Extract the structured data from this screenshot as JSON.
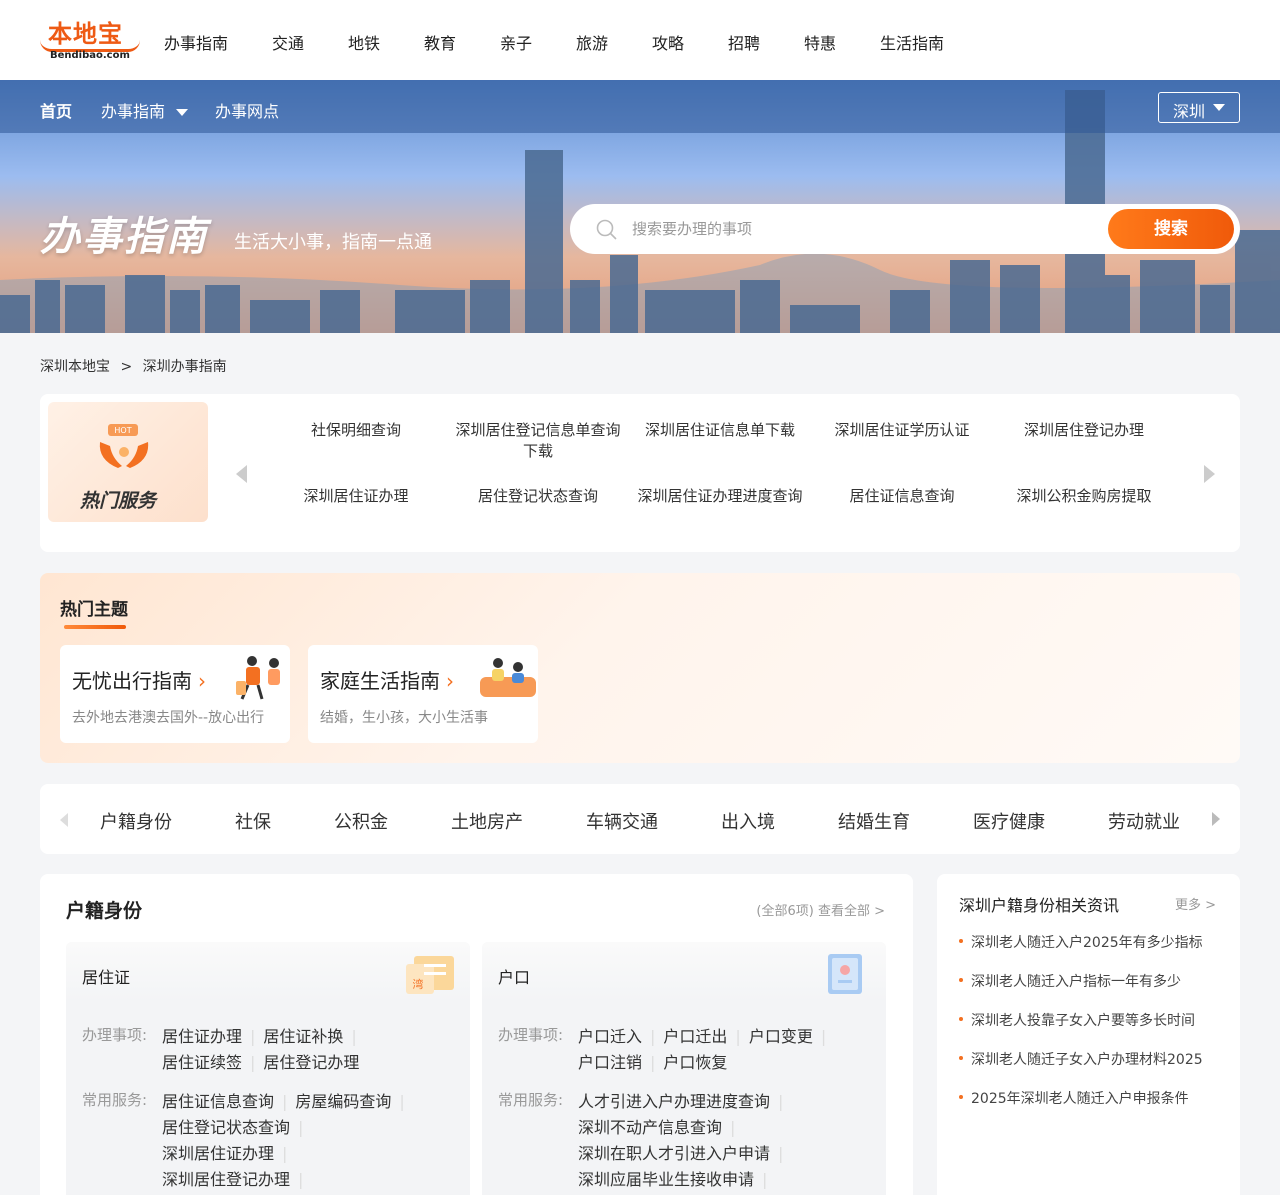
{
  "logo": {
    "cn": "本地宝",
    "en": "Bendibao.com"
  },
  "top_nav": [
    "办事指南",
    "交通",
    "地铁",
    "教育",
    "亲子",
    "旅游",
    "攻略",
    "招聘",
    "特惠",
    "生活指南"
  ],
  "sub_nav": {
    "home": "首页",
    "guide": "办事指南",
    "points": "办事网点",
    "city": "深圳"
  },
  "hero": {
    "title": "办事指南",
    "subtitle": "生活大小事，指南一点通",
    "search_placeholder": "搜索要办理的事项",
    "search_button": "搜索"
  },
  "breadcrumb": {
    "home": "深圳本地宝",
    "sep": ">",
    "current": "深圳办事指南"
  },
  "hot_service": {
    "badge_tag": "HOT",
    "badge_label": "热门服务",
    "links": [
      "社保明细查询",
      "深圳居住登记信息单查询下载",
      "深圳居住证信息单下载",
      "深圳居住证学历认证",
      "深圳居住登记办理",
      "深圳居住证办理",
      "居住登记状态查询",
      "深圳居住证办理进度查询",
      "居住证信息查询",
      "深圳公积金购房提取"
    ]
  },
  "topics": {
    "title": "热门主题",
    "cards": [
      {
        "title": "无忧出行指南",
        "desc": "去外地去港澳去国外--放心出行"
      },
      {
        "title": "家庭生活指南",
        "desc": "结婚，生小孩，大小生活事"
      }
    ]
  },
  "categories": [
    "户籍身份",
    "社保",
    "公积金",
    "土地房产",
    "车辆交通",
    "出入境",
    "结婚生育",
    "医疗健康",
    "劳动就业"
  ],
  "section": {
    "title": "户籍身份",
    "count": "(全部6项)",
    "view_all": "查看全部 >",
    "label_items": "办理事项:",
    "label_services": "常用服务:",
    "boxes": [
      {
        "title": "居住证",
        "icon_text": "湾",
        "items": [
          "居住证办理",
          "居住证补换",
          "居住证续签",
          "居住登记办理"
        ],
        "services": [
          "居住证信息查询",
          "房屋编码查询",
          "居住登记状态查询",
          "深圳居住证办理",
          "深圳居住登记办理"
        ]
      },
      {
        "title": "户口",
        "items": [
          "户口迁入",
          "户口迁出",
          "户口变更",
          "户口注销",
          "户口恢复"
        ],
        "services": [
          "人才引进入户办理进度查询",
          "深圳不动产信息查询",
          "深圳在职人才引进入户申请",
          "深圳应届毕业生接收申请"
        ]
      }
    ]
  },
  "news": {
    "title": "深圳户籍身份相关资讯",
    "more": "更多 >",
    "items": [
      "深圳老人随迁入户2025年有多少指标",
      "深圳老人随迁入户指标一年有多少",
      "深圳老人投靠子女入户要等多长时间",
      "深圳老人随迁子女入户办理材料2025",
      "2025年深圳老人随迁入户申报条件"
    ]
  }
}
